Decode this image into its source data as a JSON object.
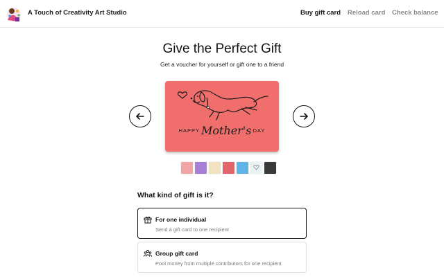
{
  "header": {
    "brand": "A Touch of Creativity Art Studio",
    "logo_icon": "artist-palette-logo",
    "nav": [
      {
        "label": "Buy gift card",
        "active": true
      },
      {
        "label": "Reload card",
        "active": false
      },
      {
        "label": "Check balance",
        "active": false
      }
    ]
  },
  "hero": {
    "title": "Give the Perfect Gift",
    "subtitle": "Get a voucher for yourself or gift one to a friend"
  },
  "carousel": {
    "prev_icon": "arrow-left-icon",
    "next_icon": "arrow-right-icon",
    "card": {
      "text_left": "HAPPY",
      "text_script": "Mother's",
      "text_right": "DAY",
      "background": "#f06e6c",
      "illustration": "dog-with-heart-illustration"
    },
    "thumbnails": [
      {
        "name": "pink-floral",
        "color": "#f2a4a6"
      },
      {
        "name": "purple-floral",
        "color": "#a77fd6"
      },
      {
        "name": "cream-floral",
        "color": "#f3e2bf"
      },
      {
        "name": "red-hearts",
        "color": "#e3656a"
      },
      {
        "name": "blue-pattern",
        "color": "#5fb6e6"
      },
      {
        "name": "heart-outline",
        "color": "#e9f2f5"
      },
      {
        "name": "dark-photo",
        "color": "#3a3a3a"
      }
    ]
  },
  "gift_type": {
    "question": "What kind of gift is it?",
    "options": [
      {
        "title": "For one individual",
        "description": "Send a gift card to one recipient",
        "icon": "gift-icon",
        "selected": true
      },
      {
        "title": "Group gift card",
        "description": "Pool money from multiple contributors for one recipient",
        "icon": "group-icon",
        "selected": false
      }
    ]
  },
  "colors": {
    "card_background": "#f06e6c",
    "nav_muted": "#8a8a8a",
    "selected_border": "#111111"
  }
}
